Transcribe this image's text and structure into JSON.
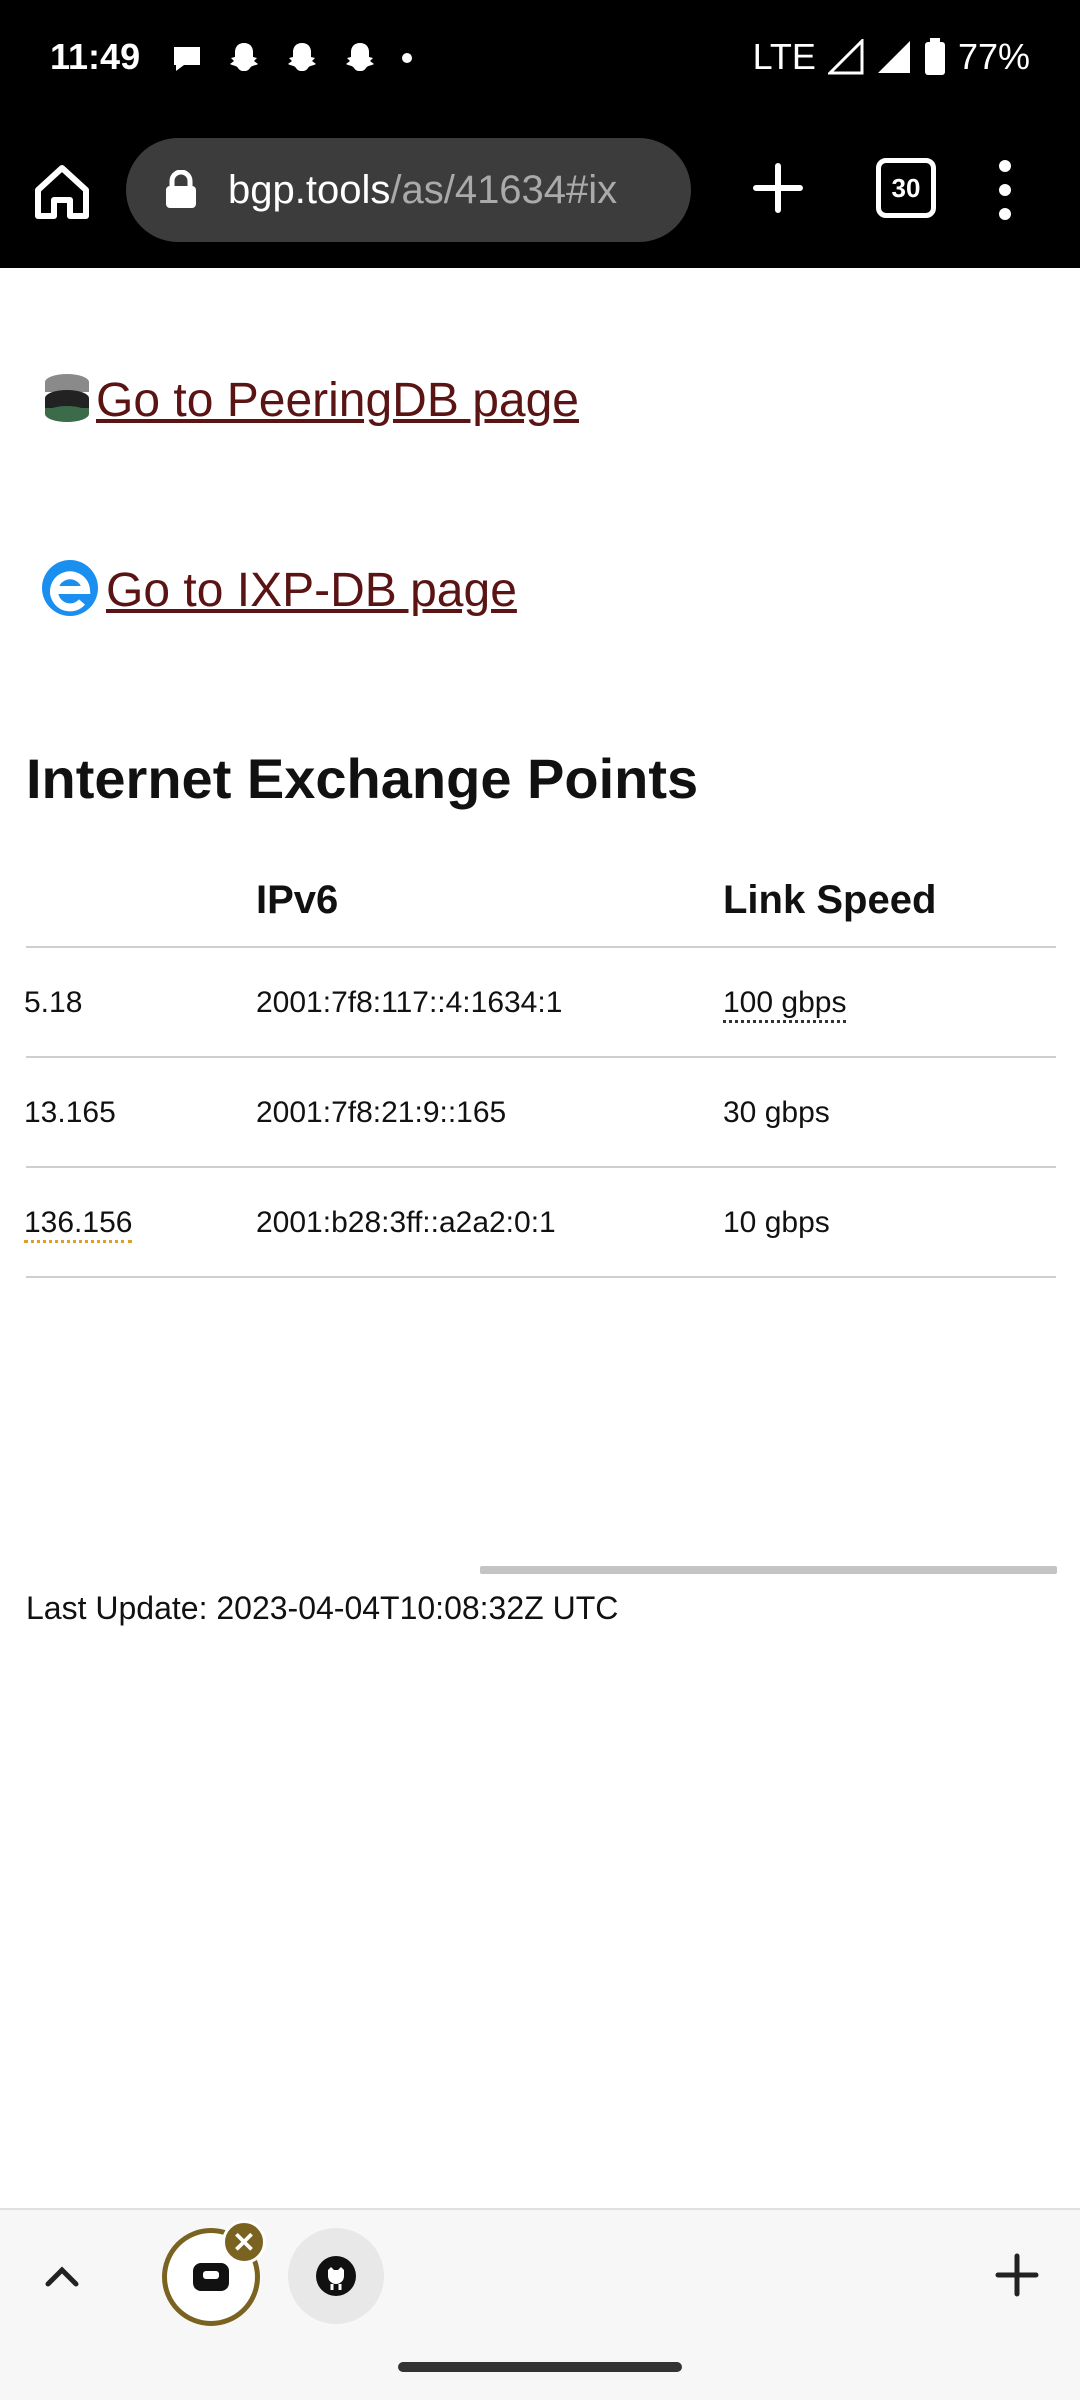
{
  "status_bar": {
    "time": "11:49",
    "network": "LTE",
    "battery": "77%",
    "notification_icons": [
      "chat-icon",
      "snapchat-icon",
      "snapchat-icon",
      "snapchat-icon",
      "dot-icon"
    ]
  },
  "browser": {
    "url_host": "bgp.tools",
    "url_path": "/as/41634#ix",
    "tab_count": "30"
  },
  "links": [
    {
      "label": "Go to PeeringDB page",
      "icon": "peeringdb-icon"
    },
    {
      "label": "Go to IXP-DB page",
      "icon": "ixpdb-icon"
    }
  ],
  "section_title": "Internet Exchange Points",
  "table": {
    "headers": [
      "IPv6",
      "Link Speed"
    ],
    "rows": [
      {
        "ipv4": "5.18",
        "ipv6": "2001:7f8:117::4:1634:1",
        "speed": "100 gbps"
      },
      {
        "ipv4": "13.165",
        "ipv6": "2001:7f8:21:9::165",
        "speed": "30 gbps"
      },
      {
        "ipv4": "136.156",
        "ipv6": "2001:b28:3ff::a2a2:0:1",
        "speed": "10 gbps"
      }
    ]
  },
  "last_update": "Last Update: 2023-04-04T10:08:32Z UTC",
  "colors": {
    "link": "#5a1414",
    "accent_tab": "#7a6221"
  }
}
